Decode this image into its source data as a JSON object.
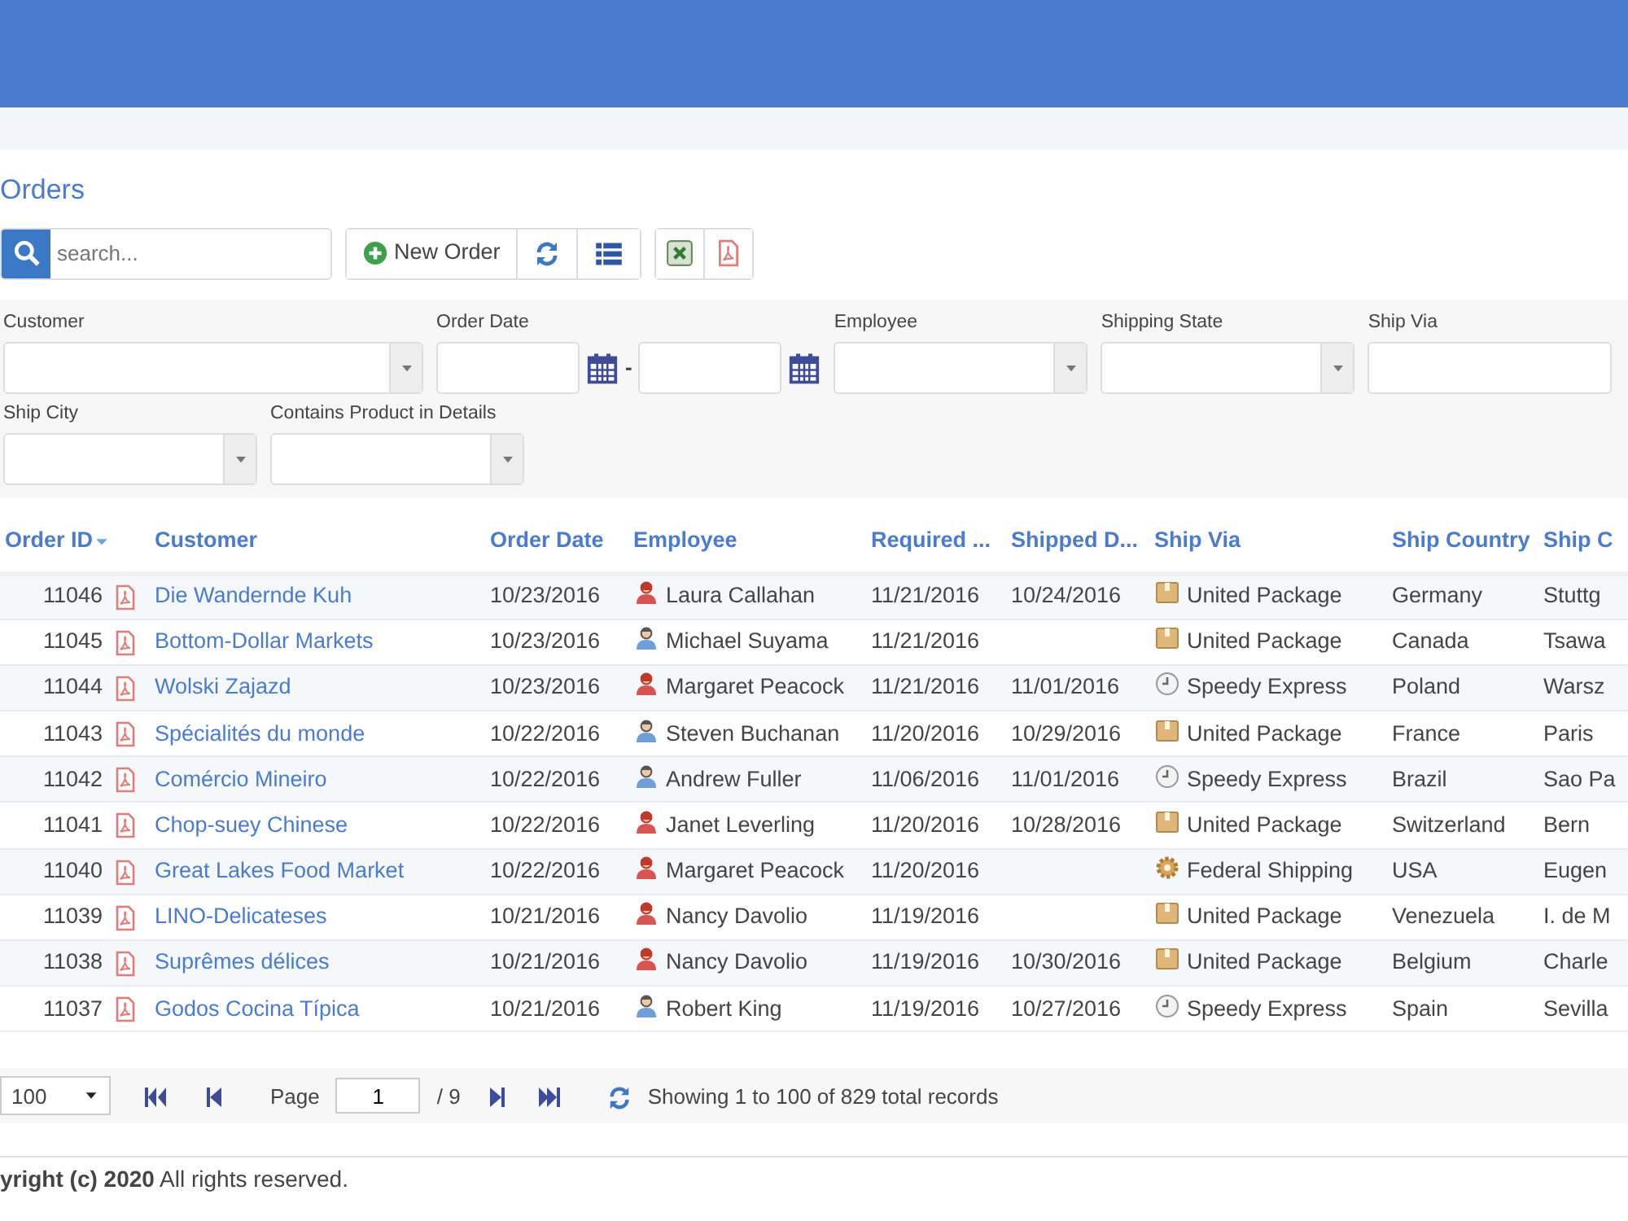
{
  "page_title": "Orders",
  "toolbar": {
    "search_placeholder": "search...",
    "new_button": "New Order"
  },
  "filters": [
    {
      "label": "Customer",
      "kind": "select"
    },
    {
      "label": "Order Date",
      "kind": "daterange",
      "separator": "-"
    },
    {
      "label": "Employee",
      "kind": "select"
    },
    {
      "label": "Shipping State",
      "kind": "select"
    },
    {
      "label": "Ship Via",
      "kind": "text"
    },
    {
      "label": "Ship City",
      "kind": "select"
    },
    {
      "label": "Contains Product in Details",
      "kind": "select"
    }
  ],
  "table": {
    "columns": [
      {
        "label": "Order ID",
        "sorted": true
      },
      {
        "label": "Customer",
        "sorted": false
      },
      {
        "label": "Order Date",
        "sorted": false
      },
      {
        "label": "Employee",
        "sorted": false
      },
      {
        "label": "Required ...",
        "sorted": false
      },
      {
        "label": "Shipped D...",
        "sorted": false
      },
      {
        "label": "Ship Via",
        "sorted": false
      },
      {
        "label": "Ship Country",
        "sorted": false
      },
      {
        "label": "Ship C",
        "sorted": false
      }
    ],
    "rows": [
      {
        "id": "11046",
        "customer": "Die Wandernde Kuh",
        "order_date": "10/23/2016",
        "employee": {
          "name": "Laura Callahan",
          "kind": "female"
        },
        "required": "11/21/2016",
        "shipped": "10/24/2016",
        "ship_via": {
          "name": "United Package",
          "kind": "package"
        },
        "country": "Germany",
        "city": "Stuttg"
      },
      {
        "id": "11045",
        "customer": "Bottom-Dollar Markets",
        "order_date": "10/23/2016",
        "employee": {
          "name": "Michael Suyama",
          "kind": "male"
        },
        "required": "11/21/2016",
        "ship_via": {
          "name": "United Package",
          "kind": "package"
        },
        "country": "Canada",
        "city": "Tsawa"
      },
      {
        "id": "11044",
        "customer": "Wolski Zajazd",
        "order_date": "10/23/2016",
        "employee": {
          "name": "Margaret Peacock",
          "kind": "female"
        },
        "required": "11/21/2016",
        "shipped": "11/01/2016",
        "ship_via": {
          "name": "Speedy Express",
          "kind": "clock"
        },
        "country": "Poland",
        "city": "Warsz"
      },
      {
        "id": "11043",
        "customer": "Spécialités du monde",
        "order_date": "10/22/2016",
        "employee": {
          "name": "Steven Buchanan",
          "kind": "male"
        },
        "required": "11/20/2016",
        "shipped": "10/29/2016",
        "ship_via": {
          "name": "United Package",
          "kind": "package"
        },
        "country": "France",
        "city": "Paris"
      },
      {
        "id": "11042",
        "customer": "Comércio Mineiro",
        "order_date": "10/22/2016",
        "employee": {
          "name": "Andrew Fuller",
          "kind": "male"
        },
        "required": "11/06/2016",
        "shipped": "11/01/2016",
        "ship_via": {
          "name": "Speedy Express",
          "kind": "clock"
        },
        "country": "Brazil",
        "city": "Sao Pa"
      },
      {
        "id": "11041",
        "customer": "Chop-suey Chinese",
        "order_date": "10/22/2016",
        "employee": {
          "name": "Janet Leverling",
          "kind": "female"
        },
        "required": "11/20/2016",
        "shipped": "10/28/2016",
        "ship_via": {
          "name": "United Package",
          "kind": "package"
        },
        "country": "Switzerland",
        "city": "Bern"
      },
      {
        "id": "11040",
        "customer": "Great Lakes Food Market",
        "order_date": "10/22/2016",
        "employee": {
          "name": "Margaret Peacock",
          "kind": "female"
        },
        "required": "11/20/2016",
        "ship_via": {
          "name": "Federal Shipping",
          "kind": "gear"
        },
        "country": "USA",
        "city": "Eugen"
      },
      {
        "id": "11039",
        "customer": "LINO-Delicateses",
        "order_date": "10/21/2016",
        "employee": {
          "name": "Nancy Davolio",
          "kind": "female"
        },
        "required": "11/19/2016",
        "ship_via": {
          "name": "United Package",
          "kind": "package"
        },
        "country": "Venezuela",
        "city": "I. de M"
      },
      {
        "id": "11038",
        "customer": "Suprêmes délices",
        "order_date": "10/21/2016",
        "employee": {
          "name": "Nancy Davolio",
          "kind": "female"
        },
        "required": "11/19/2016",
        "shipped": "10/30/2016",
        "ship_via": {
          "name": "United Package",
          "kind": "package"
        },
        "country": "Belgium",
        "city": "Charle"
      },
      {
        "id": "11037",
        "customer": "Godos Cocina Típica",
        "order_date": "10/21/2016",
        "employee": {
          "name": "Robert King",
          "kind": "male"
        },
        "required": "11/19/2016",
        "shipped": "10/27/2016",
        "ship_via": {
          "name": "Speedy Express",
          "kind": "clock"
        },
        "country": "Spain",
        "city": "Sevilla"
      }
    ]
  },
  "pager": {
    "page_size": "100",
    "page_label": "Page",
    "page": "1",
    "page_count": "/ 9",
    "summary": "Showing 1 to 100 of 829 total records"
  },
  "footer": "**yright (c) 2020** All rights reserved."
}
